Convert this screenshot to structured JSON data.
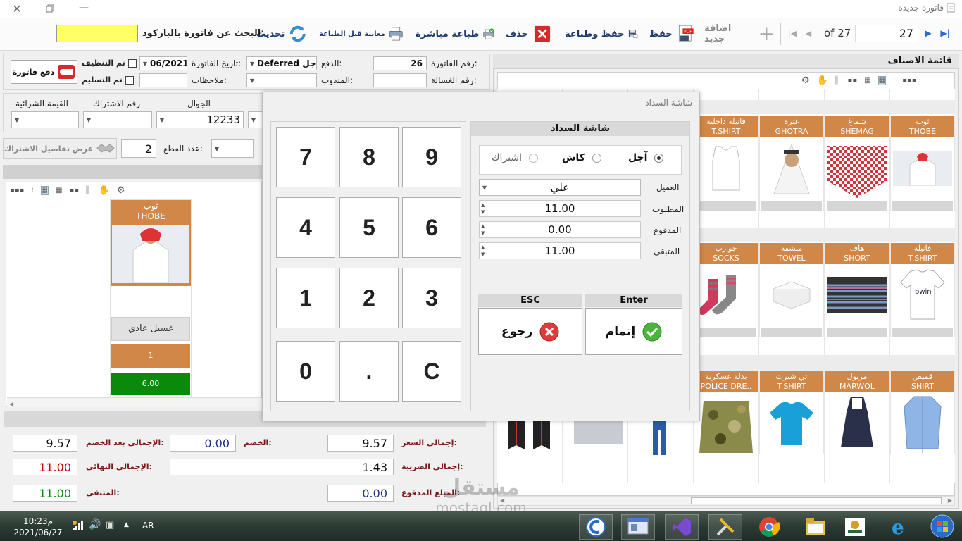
{
  "window": {
    "title": "فاتورة جديدة"
  },
  "toolbar": {
    "page_current": "27",
    "page_total": "of 27",
    "add_new": "اضافة جديد",
    "save": "حفظ",
    "save_print": "حفظ وطباعة",
    "delete": "حذف",
    "direct_print": "طباعة مباشرة",
    "print_preview": "معاينة قبل الطباعة",
    "refresh": "تحديث",
    "barcode_search_label": "البحث عن فاتورة بالباركود:",
    "barcode_value": ""
  },
  "invoice": {
    "number_label": "رقم الفاتورة:",
    "number": "26",
    "payment_label": "الدفع:",
    "payment": "Deferred آجل",
    "date_label": "تاريخ الفاتورة:",
    "date": "06/2021",
    "cleaned_label": "تم التنظيف",
    "washer_label": "رقم الغسالة:",
    "washer": "",
    "delegate_label": "المندوب:",
    "delegate": "",
    "notes_label": "ملاحظات:",
    "notes": "",
    "delivered_label": "تم التسليم",
    "pay_invoice_button": "دفع فاتورة"
  },
  "customer": {
    "mobile_label": "الجوال",
    "mobile": "12233",
    "subscription_label": "رقم الاشتراك",
    "subscription": "",
    "purchase_value_label": "القيمة الشرائية",
    "purchase_value": "",
    "pieces_label": "عدد القطع:",
    "pieces": "2",
    "view_subscription_button": "عرض تفاصيل الاشتراك"
  },
  "cart_item": {
    "name_ar": "ثوب",
    "name_en": "THOBE",
    "service": "غسيل عادي",
    "qty": "1",
    "price": "6.00"
  },
  "totals": {
    "total_price_label": "إجمالي السعر:",
    "total_price": "9.57",
    "discount_label": "الخصم:",
    "discount": "0.00",
    "after_discount_label": "الإجمالي بعد الخصم:",
    "after_discount": "9.57",
    "tax_label": "إجمالي الضريبة:",
    "tax": "1.43",
    "final_label": "الإجمالي النهائي:",
    "final": "11.00",
    "paid_label": "المبلغ المدفوع:",
    "paid": "0.00",
    "remaining_label": "المتبقي:",
    "remaining": "11.00"
  },
  "products_panel": {
    "title": "قائمة الاصناف",
    "items": [
      {
        "ar": "ثوب",
        "en": "THOBE"
      },
      {
        "ar": "شماغ",
        "en": "SHEMAG"
      },
      {
        "ar": "غترة",
        "en": "GHOTRA"
      },
      {
        "ar": "فانيلة داخلية",
        "en": "T.SHIRT"
      },
      {
        "ar": "فانيلة",
        "en": "T.SHIRT"
      },
      {
        "ar": "هاف",
        "en": "SHORT"
      },
      {
        "ar": "منشفة",
        "en": "TOWEL"
      },
      {
        "ar": "جوارب",
        "en": "SOCKS"
      },
      {
        "ar": "قميص",
        "en": "SHIRT"
      },
      {
        "ar": "مريول",
        "en": "MARWOL"
      },
      {
        "ar": "تي شيرت",
        "en": "T.SHIRT"
      },
      {
        "ar": "بدلة عسكرية",
        "en": "POLICE DRE.."
      }
    ]
  },
  "payment_dialog": {
    "window_title": "شاشة السداد",
    "header": "شاشة السداد",
    "option_deferred": "آجل",
    "option_cash": "كاش",
    "option_subscription": "اشتراك",
    "customer_label": "العميل",
    "customer": "علي",
    "required_label": "المطلوب",
    "required": "11.00",
    "paid_label": "المدفوع",
    "paid": "0.00",
    "remaining_label": "المتبقي",
    "remaining": "11.00",
    "enter_key": "Enter",
    "esc_key": "ESC",
    "confirm_button": "إتمام",
    "back_button": "رجوع",
    "keys": [
      "7",
      "8",
      "9",
      "4",
      "5",
      "6",
      "1",
      "2",
      "3",
      "0",
      ".",
      "C"
    ]
  },
  "taskbar": {
    "time": "10:23م",
    "date": "2021/06/27",
    "lang": "AR"
  },
  "watermark": {
    "text": "mostaql.com",
    "brand": "مستقل"
  },
  "colors": {
    "accent_orange": "#d18748",
    "price_green": "#0a8a0a",
    "yellow_input": "#ffff66"
  }
}
